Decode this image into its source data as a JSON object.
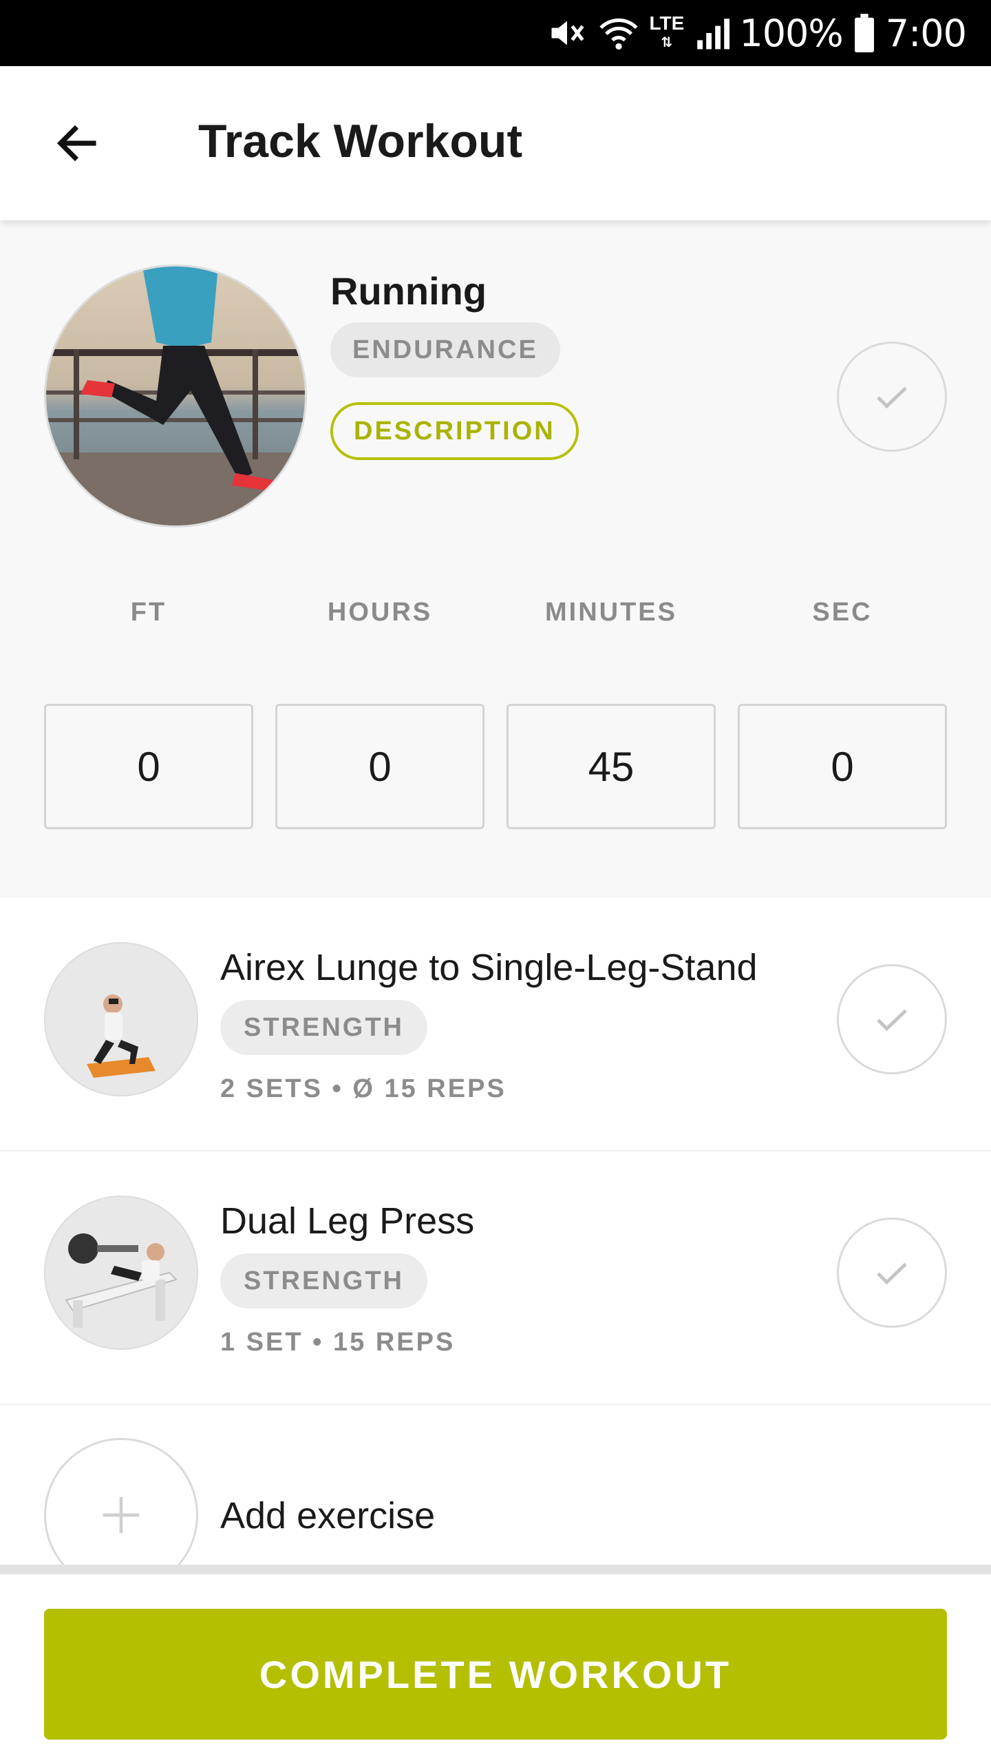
{
  "status_bar": {
    "battery": "100%",
    "time": "7:00",
    "network": "LTE",
    "icons": [
      "mute-vibrate-icon",
      "wifi-icon",
      "lte-icon",
      "signal-icon",
      "battery-icon"
    ]
  },
  "app_bar": {
    "title": "Track Workout",
    "back_icon": "arrow-left-icon"
  },
  "hero": {
    "name": "Running",
    "category": "ENDURANCE",
    "description_label": "DESCRIPTION",
    "metrics": [
      {
        "label": "FT",
        "value": "0"
      },
      {
        "label": "HOURS",
        "value": "0"
      },
      {
        "label": "MINUTES",
        "value": "45"
      },
      {
        "label": "SEC",
        "value": "0"
      }
    ]
  },
  "exercises": [
    {
      "name": "Airex Lunge to Single-Leg-Stand",
      "category": "STRENGTH",
      "meta": "2 SETS • Ø 15 REPS"
    },
    {
      "name": "Dual Leg Press",
      "category": "STRENGTH",
      "meta": "1 SET • 15 REPS"
    }
  ],
  "add_exercise": {
    "label": "Add exercise"
  },
  "complete_button": {
    "label": "COMPLETE WORKOUT"
  },
  "colors": {
    "accent": "#b3bf00",
    "accent_text": "#a8b400",
    "chip_bg": "#e8e8e8",
    "muted_text": "#8c8c8c"
  }
}
